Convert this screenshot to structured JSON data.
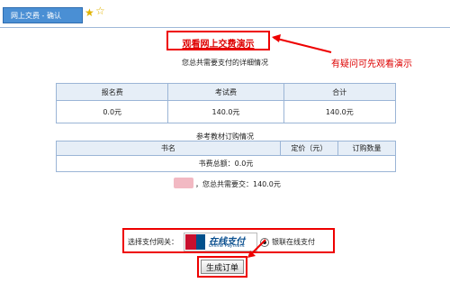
{
  "tab": {
    "title": "网上交费 - 确认"
  },
  "demo": {
    "link": "观看网上交费演示",
    "hint": "有疑问可先观看演示"
  },
  "fees": {
    "title": "您总共需要支付的详细情况",
    "headers": [
      "报名费",
      "考试费",
      "合计"
    ],
    "values": [
      "0.0元",
      "140.0元",
      "140.0元"
    ]
  },
  "books": {
    "title": "参考教材订购情况",
    "headers": [
      "书名",
      "定价（元）",
      "订购数量"
    ],
    "total": "书费总额：0.0元"
  },
  "summary": {
    "text": "，您总共需要交：140.0元"
  },
  "payment": {
    "label": "选择支付网关：",
    "logo_main": "在线支付",
    "logo_sub": "Online Payment",
    "option": "银联在线支付",
    "accent": "#e00000"
  },
  "submit": {
    "label": "生成订单"
  }
}
